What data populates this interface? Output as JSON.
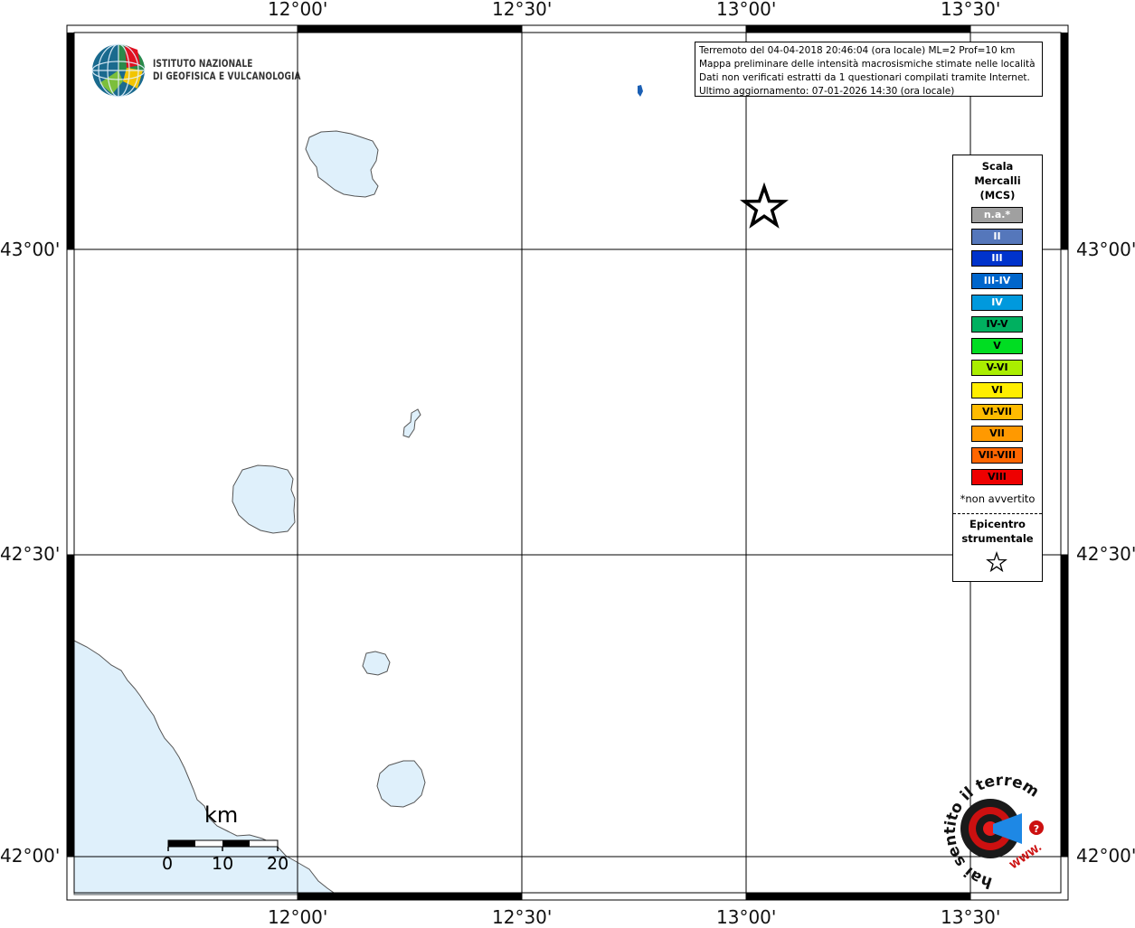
{
  "grid": {
    "top_labels": [
      "12°00'",
      "12°30'",
      "13°00'",
      "13°30'"
    ],
    "bottom_labels": [
      "12°00'",
      "12°30'",
      "13°00'",
      "13°30'"
    ],
    "left_labels": [
      "43°00'",
      "42°30'",
      "42°00'"
    ],
    "right_labels": [
      "43°00'",
      "42°30'",
      "42°00'"
    ]
  },
  "logo": {
    "line1": "ISTITUTO NAZIONALE",
    "line2": "DI GEOFISICA E VULCANOLOGIA"
  },
  "info": {
    "line1": "Terremoto del 04-04-2018 20:46:04 (ora locale) ML=2 Prof=10 km",
    "line2": "Mappa preliminare delle intensità macrosismiche stimate nelle località",
    "line3": "Dati non verificati estratti da 1 questionari compilati tramite Internet.",
    "line4": "Ultimo aggiornamento: 07-01-2026 14:30 (ora locale)"
  },
  "legend": {
    "title_line1": "Scala",
    "title_line2": "Mercalli",
    "title_line3": "(MCS)",
    "items": [
      {
        "label": "n.a.*",
        "color": "#a0a0a0",
        "text_color": "#ffffff"
      },
      {
        "label": "II",
        "color": "#5577bb",
        "text_color": "#ffffff"
      },
      {
        "label": "III",
        "color": "#0033cc",
        "text_color": "#ffffff"
      },
      {
        "label": "III-IV",
        "color": "#0066cc",
        "text_color": "#ffffff"
      },
      {
        "label": "IV",
        "color": "#0099dd",
        "text_color": "#ffffff"
      },
      {
        "label": "IV-V",
        "color": "#00b060",
        "text_color": "#000000"
      },
      {
        "label": "V",
        "color": "#00dd22",
        "text_color": "#000000"
      },
      {
        "label": "V-VI",
        "color": "#aaee00",
        "text_color": "#000000"
      },
      {
        "label": "VI",
        "color": "#ffee00",
        "text_color": "#000000"
      },
      {
        "label": "VI-VII",
        "color": "#ffbb00",
        "text_color": "#000000"
      },
      {
        "label": "VII",
        "color": "#ff9900",
        "text_color": "#000000"
      },
      {
        "label": "VII-VIII",
        "color": "#ff6600",
        "text_color": "#000000"
      },
      {
        "label": "VIII",
        "color": "#ee0000",
        "text_color": "#000000"
      }
    ],
    "note": "*non avvertito",
    "epicenter_line1": "Epicentro",
    "epicenter_line2": "strumentale"
  },
  "scalebar": {
    "unit": "km",
    "ticks": [
      "0",
      "10",
      "20"
    ]
  },
  "brand": {
    "text": "hai sentito il terremoto.it",
    "url": "WWW."
  },
  "colors": {
    "water": "#dff0fb",
    "felt_marker": "#1a5fb4"
  }
}
